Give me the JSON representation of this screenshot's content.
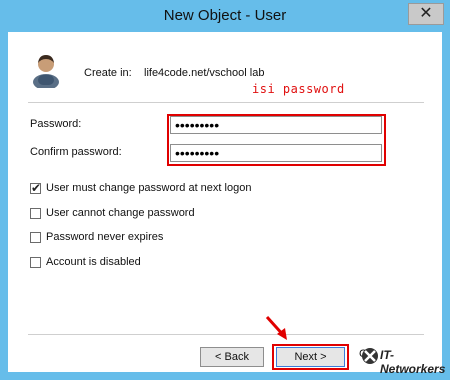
{
  "window": {
    "title": "New Object - User",
    "close_glyph": "✕"
  },
  "header": {
    "create_in_label": "Create in:",
    "create_in_path": "life4code.net/vschool lab",
    "annotation": "isi password",
    "annotation_color": "#e01010"
  },
  "form": {
    "password_label": "Password:",
    "password_value": "•••••••••",
    "confirm_label": "Confirm password:",
    "confirm_value": "•••••••••"
  },
  "options": [
    {
      "label": "User must change password at next logon",
      "checked": true
    },
    {
      "label": "User cannot change password",
      "checked": false
    },
    {
      "label": "Password never expires",
      "checked": false
    },
    {
      "label": "Account is disabled",
      "checked": false
    }
  ],
  "buttons": {
    "back_label": "< Back",
    "next_label": "Next >",
    "cancel_label": "Ca",
    "watermark": "IT-Networkers"
  },
  "colors": {
    "titlebar": "#66bdea",
    "highlight": "#e00000"
  },
  "icons": {
    "user": "user-icon",
    "close": "close-icon",
    "arrow": "red-arrow-icon",
    "logo": "watermark-logo-icon"
  }
}
